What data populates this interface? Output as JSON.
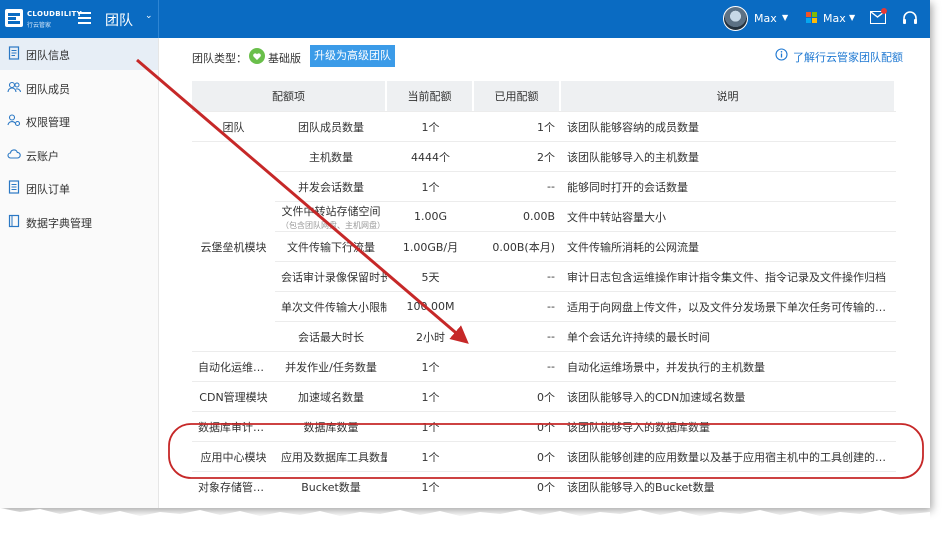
{
  "topbar": {
    "brand": "CLOUDBILITY",
    "brand_cn": "行云管家",
    "team_title": "团队",
    "user1_name": "Max",
    "user2_name": "Max"
  },
  "sidebar": {
    "items": [
      {
        "label": "团队信息",
        "icon": "document-icon",
        "active": true
      },
      {
        "label": "团队成员",
        "icon": "users-icon",
        "active": false
      },
      {
        "label": "权限管理",
        "icon": "user-gear-icon",
        "active": false
      },
      {
        "label": "云账户",
        "icon": "cloud-icon",
        "active": false
      },
      {
        "label": "团队订单",
        "icon": "order-icon",
        "active": false
      },
      {
        "label": "数据字典管理",
        "icon": "book-icon",
        "active": false
      }
    ]
  },
  "team_type": {
    "label": "团队类型：",
    "current": "基础版",
    "upgrade_label": "升级为高级团队",
    "learn_link": "了解行云管家团队配额"
  },
  "table": {
    "headers": [
      "配额项",
      "当前配额",
      "已用配额",
      "说明"
    ],
    "rows": [
      {
        "module": "团队",
        "name": "团队成员数量",
        "sub": "",
        "current": "1个",
        "used": "1个",
        "desc": "该团队能够容纳的成员数量"
      },
      {
        "module": "",
        "name": "主机数量",
        "sub": "",
        "current": "4444个",
        "used": "2个",
        "desc": "该团队能够导入的主机数量"
      },
      {
        "module": "",
        "name": "并发会话数量",
        "sub": "",
        "current": "1个",
        "used": "--",
        "desc": "能够同时打开的会话数量"
      },
      {
        "module": "",
        "name": "文件中转站存储空间",
        "sub": "（包含团队网盘、主机网盘）",
        "current": "1.00G",
        "used": "0.00B",
        "desc": "文件中转站容量大小"
      },
      {
        "module": "云堡垒机模块",
        "name": "文件传输下行流量",
        "sub": "",
        "current": "1.00GB/月",
        "used": "0.00B(本月)",
        "desc": "文件传输所消耗的公网流量"
      },
      {
        "module": "",
        "name": "会话审计录像保留时长",
        "sub": "",
        "current": "5天",
        "used": "--",
        "desc": "审计日志包含运维操作审计指令集文件、指令记录及文件操作归档"
      },
      {
        "module": "",
        "name": "单次文件传输大小限制",
        "sub": "",
        "current": "100.00M",
        "used": "--",
        "desc": "适用于向网盘上传文件，以及文件分发场景下单次任务可传输的文件总..."
      },
      {
        "module": "",
        "name": "会话最大时长",
        "sub": "",
        "current": "2小时",
        "used": "--",
        "desc": "单个会话允许持续的最长时间"
      },
      {
        "module": "自动化运维模块",
        "name": "并发作业/任务数量",
        "sub": "",
        "current": "1个",
        "used": "--",
        "desc": "自动化运维场景中，并发执行的主机数量"
      },
      {
        "module": "CDN管理模块",
        "name": "加速域名数量",
        "sub": "",
        "current": "1个",
        "used": "0个",
        "desc": "该团队能够导入的CDN加速域名数量"
      },
      {
        "module": "数据库审计模块",
        "name": "数据库数量",
        "sub": "",
        "current": "1个",
        "used": "0个",
        "desc": "该团队能够导入的数据库数量"
      },
      {
        "module": "应用中心模块",
        "name": "应用及数据库工具数量",
        "sub": "",
        "current": "1个",
        "used": "0个",
        "desc": "该团队能够创建的应用数量以及基于应用宿主机中的工具创建的数据库..."
      },
      {
        "module": "对象存储管理模块",
        "name": "Bucket数量",
        "sub": "",
        "current": "1个",
        "used": "0个",
        "desc": "该团队能够导入的Bucket数量"
      }
    ]
  },
  "colors": {
    "topbar": "#0a6bc2",
    "accent": "#3b9be8",
    "annotation": "#c62828"
  }
}
